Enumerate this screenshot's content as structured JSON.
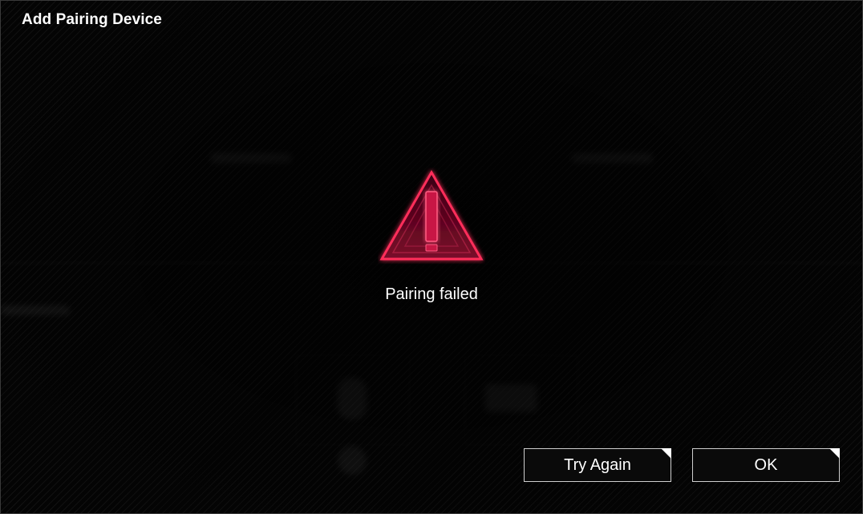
{
  "dialog": {
    "title": "Add Pairing Device"
  },
  "status": {
    "icon": "warning-triangle-icon",
    "message": "Pairing failed",
    "accent_color": "#ff2d5a"
  },
  "buttons": {
    "try_again_label": "Try Again",
    "ok_label": "OK"
  }
}
